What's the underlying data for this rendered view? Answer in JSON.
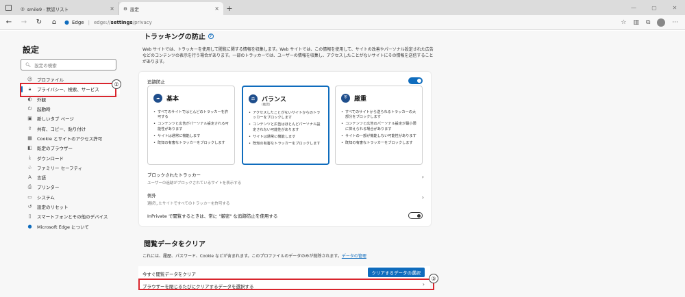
{
  "tabs": [
    {
      "title": "smile9 - 默認リスト",
      "active": false
    },
    {
      "title": "設定",
      "active": true
    }
  ],
  "address": {
    "site": "Edge",
    "url_prefix": "edge://",
    "url_main": "settings",
    "url_rest": "/privacy"
  },
  "sidebar": {
    "title": "設定",
    "search_placeholder": "設定の検索",
    "items": [
      {
        "label": "プロファイル",
        "icon": "user-icon"
      },
      {
        "label": "プライバシー、検索、サービス",
        "icon": "lock-icon",
        "selected": true
      },
      {
        "label": "外観",
        "icon": "appearance-icon"
      },
      {
        "label": "起動時",
        "icon": "power-icon"
      },
      {
        "label": "新しいタブ ページ",
        "icon": "newtab-icon"
      },
      {
        "label": "共有、コピー、貼り付け",
        "icon": "share-icon"
      },
      {
        "label": "Cookie とサイトのアクセス許可",
        "icon": "cookie-icon"
      },
      {
        "label": "既定のブラウザー",
        "icon": "browser-icon"
      },
      {
        "label": "ダウンロード",
        "icon": "download-icon"
      },
      {
        "label": "ファミリー セーフティ",
        "icon": "family-icon"
      },
      {
        "label": "言語",
        "icon": "language-icon"
      },
      {
        "label": "プリンター",
        "icon": "printer-icon"
      },
      {
        "label": "システム",
        "icon": "system-icon"
      },
      {
        "label": "設定のリセット",
        "icon": "reset-icon"
      },
      {
        "label": "スマートフォンとその他のデバイス",
        "icon": "phone-icon"
      },
      {
        "label": "Microsoft Edge について",
        "icon": "edge-icon"
      }
    ]
  },
  "badges": {
    "b2": "②",
    "b3": "③"
  },
  "tracking": {
    "title": "トラッキングの防止",
    "description": "Web サイトでは、トラッカーを使用して閲覧に関する情報を収集します。Web サイトでは、この情報を使用して、サイトの改善やパーソナル設定された広告などのコンテンツの表示を行う場合があります。一部のトラッカーでは、ユーザーの情報を収集し、アクセスしたことがないサイトにその情報を送信することがあります。",
    "label": "追跡防止",
    "toggle_on": true,
    "options": [
      {
        "name": "基本",
        "sub": "",
        "selected": false,
        "bullets": [
          "すべてのサイトではとんどのトラッカーを許可する",
          "コンテンツと広告がパーソナル設定される可能性があります",
          "サイトは通常に機能します",
          "既知の有害なトラッカーをブロックします"
        ]
      },
      {
        "name": "バランス",
        "sub": "(推奨)",
        "selected": true,
        "bullets": [
          "アクセスしたことがないサイトからのトラッカーをブロックします",
          "コンテンツと広告はほとんどパーソナル設定されない可能性があります",
          "サイトは通常に機能します",
          "既知の有害なトラッカーをブロックします"
        ]
      },
      {
        "name": "厳重",
        "sub": "",
        "selected": false,
        "bullets": [
          "すべてのサイトから送られるトラッカーの大部分をブロックします",
          "コンテンツと広告のパーソナル設定が最小限に抑えられる場合があります",
          "サイトの一部が機能しない可能性があります",
          "既知の有害なトラッカーをブロックします"
        ]
      }
    ],
    "blocked_title": "ブロックされたトラッカー",
    "blocked_sub": "ユーザーの追跡がブロックされているサイトを表示する",
    "exceptions_title": "例外",
    "exceptions_sub": "選択したサイトですべてのトラッカーを許可する",
    "inprivate": "InPrivate で閲覧するときは、常に \"厳密\" な追跡防止を使用する",
    "inprivate_on": false
  },
  "clear": {
    "title": "閲覧データをクリア",
    "description": "これには、履歴、パスワード、Cookie などが含まれます。このプロファイルのデータのみが削除されます。",
    "link": "データの管理",
    "now_label": "今すぐ閲覧データをクリア",
    "button": "クリアするデータの選択",
    "on_close": "ブラウザーを閉じるたびにクリアするデータを選択する"
  }
}
